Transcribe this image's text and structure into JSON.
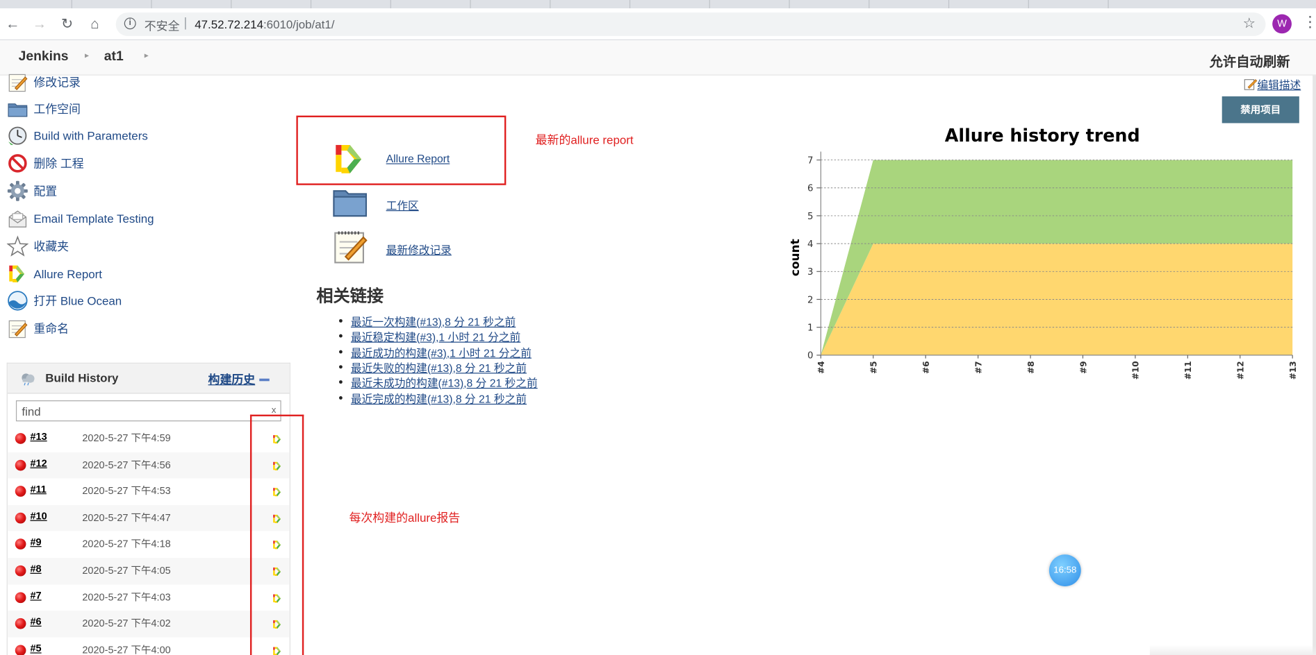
{
  "browser": {
    "address_security": "不安全",
    "address_host": "47.52.72.214",
    "address_path": ":6010/job/at1/",
    "profile_initial": "W"
  },
  "header": {
    "crumbs": [
      "Jenkins",
      "at1"
    ],
    "auto_refresh": "允许自动刷新"
  },
  "side_tasks": [
    {
      "label": "修改记录",
      "icon": "notepad-icon"
    },
    {
      "label": "工作空间",
      "icon": "folder-icon"
    },
    {
      "label": "Build with Parameters",
      "icon": "clock-icon"
    },
    {
      "label": "删除 工程",
      "icon": "no-entry-icon"
    },
    {
      "label": "配置",
      "icon": "gear-icon"
    },
    {
      "label": "Email Template Testing",
      "icon": "envelope-icon"
    },
    {
      "label": "收藏夹",
      "icon": "star-icon"
    },
    {
      "label": "Allure Report",
      "icon": "allure-icon"
    },
    {
      "label": "打开 Blue Ocean",
      "icon": "blue-ocean-icon"
    },
    {
      "label": "重命名",
      "icon": "notepad-icon"
    }
  ],
  "build_history": {
    "title": "Build History",
    "trend_link": "构建历史",
    "search_value": "find",
    "clear": "x",
    "builds": [
      {
        "num": "#13",
        "date": "2020-5-27 下午4:59",
        "status": "failed"
      },
      {
        "num": "#12",
        "date": "2020-5-27 下午4:56",
        "status": "failed"
      },
      {
        "num": "#11",
        "date": "2020-5-27 下午4:53",
        "status": "failed"
      },
      {
        "num": "#10",
        "date": "2020-5-27 下午4:47",
        "status": "failed"
      },
      {
        "num": "#9",
        "date": "2020-5-27 下午4:18",
        "status": "failed"
      },
      {
        "num": "#8",
        "date": "2020-5-27 下午4:05",
        "status": "failed"
      },
      {
        "num": "#7",
        "date": "2020-5-27 下午4:03",
        "status": "failed"
      },
      {
        "num": "#6",
        "date": "2020-5-27 下午4:02",
        "status": "failed"
      },
      {
        "num": "#5",
        "date": "2020-5-27 下午4:00",
        "status": "failed"
      }
    ]
  },
  "main": {
    "big_links": [
      {
        "label": "Allure Report",
        "icon": "allure-icon"
      },
      {
        "label": "工作区",
        "icon": "folder-icon"
      },
      {
        "label": "最新修改记录",
        "icon": "notepad-icon"
      }
    ],
    "annotation_latest": "最新的allure report",
    "annotation_each": "每次构建的allure报告",
    "related_heading": "相关链接",
    "related_links": [
      "最近一次构建(#13),8 分 21 秒之前",
      "最近稳定构建(#3),1 小时 21 分之前",
      "最近成功的构建(#3),1 小时 21 分之前",
      "最近失败的构建(#13),8 分 21 秒之前",
      "最近未成功的构建(#13),8 分 21 秒之前",
      "最近完成的构建(#13),8 分 21 秒之前"
    ],
    "edit_description": "编辑描述",
    "disable_button": "禁用项目"
  },
  "clock_widget": "16:58",
  "colors": {
    "jenkins_link": "#204a87",
    "annotation_red": "#e02020",
    "area_green": "#a9d57d",
    "area_yellow": "#ffd76f",
    "disable_button": "#4b758b"
  },
  "chart_data": {
    "type": "area",
    "title": "Allure history trend",
    "xlabel": "",
    "ylabel": "count",
    "x": [
      "#4",
      "#5",
      "#6",
      "#7",
      "#8",
      "#9",
      "#10",
      "#11",
      "#12",
      "#13"
    ],
    "ylim": [
      0,
      7
    ],
    "yticks": [
      0,
      1,
      2,
      3,
      4,
      5,
      6,
      7
    ],
    "grid": true,
    "stacked": true,
    "series": [
      {
        "color": "#ffd76f",
        "values": [
          0,
          4,
          4,
          4,
          4,
          4,
          4,
          4,
          4,
          4
        ]
      },
      {
        "color": "#a9d57d",
        "values": [
          0,
          3,
          3,
          3,
          3,
          3,
          3,
          3,
          3,
          3
        ]
      }
    ]
  }
}
